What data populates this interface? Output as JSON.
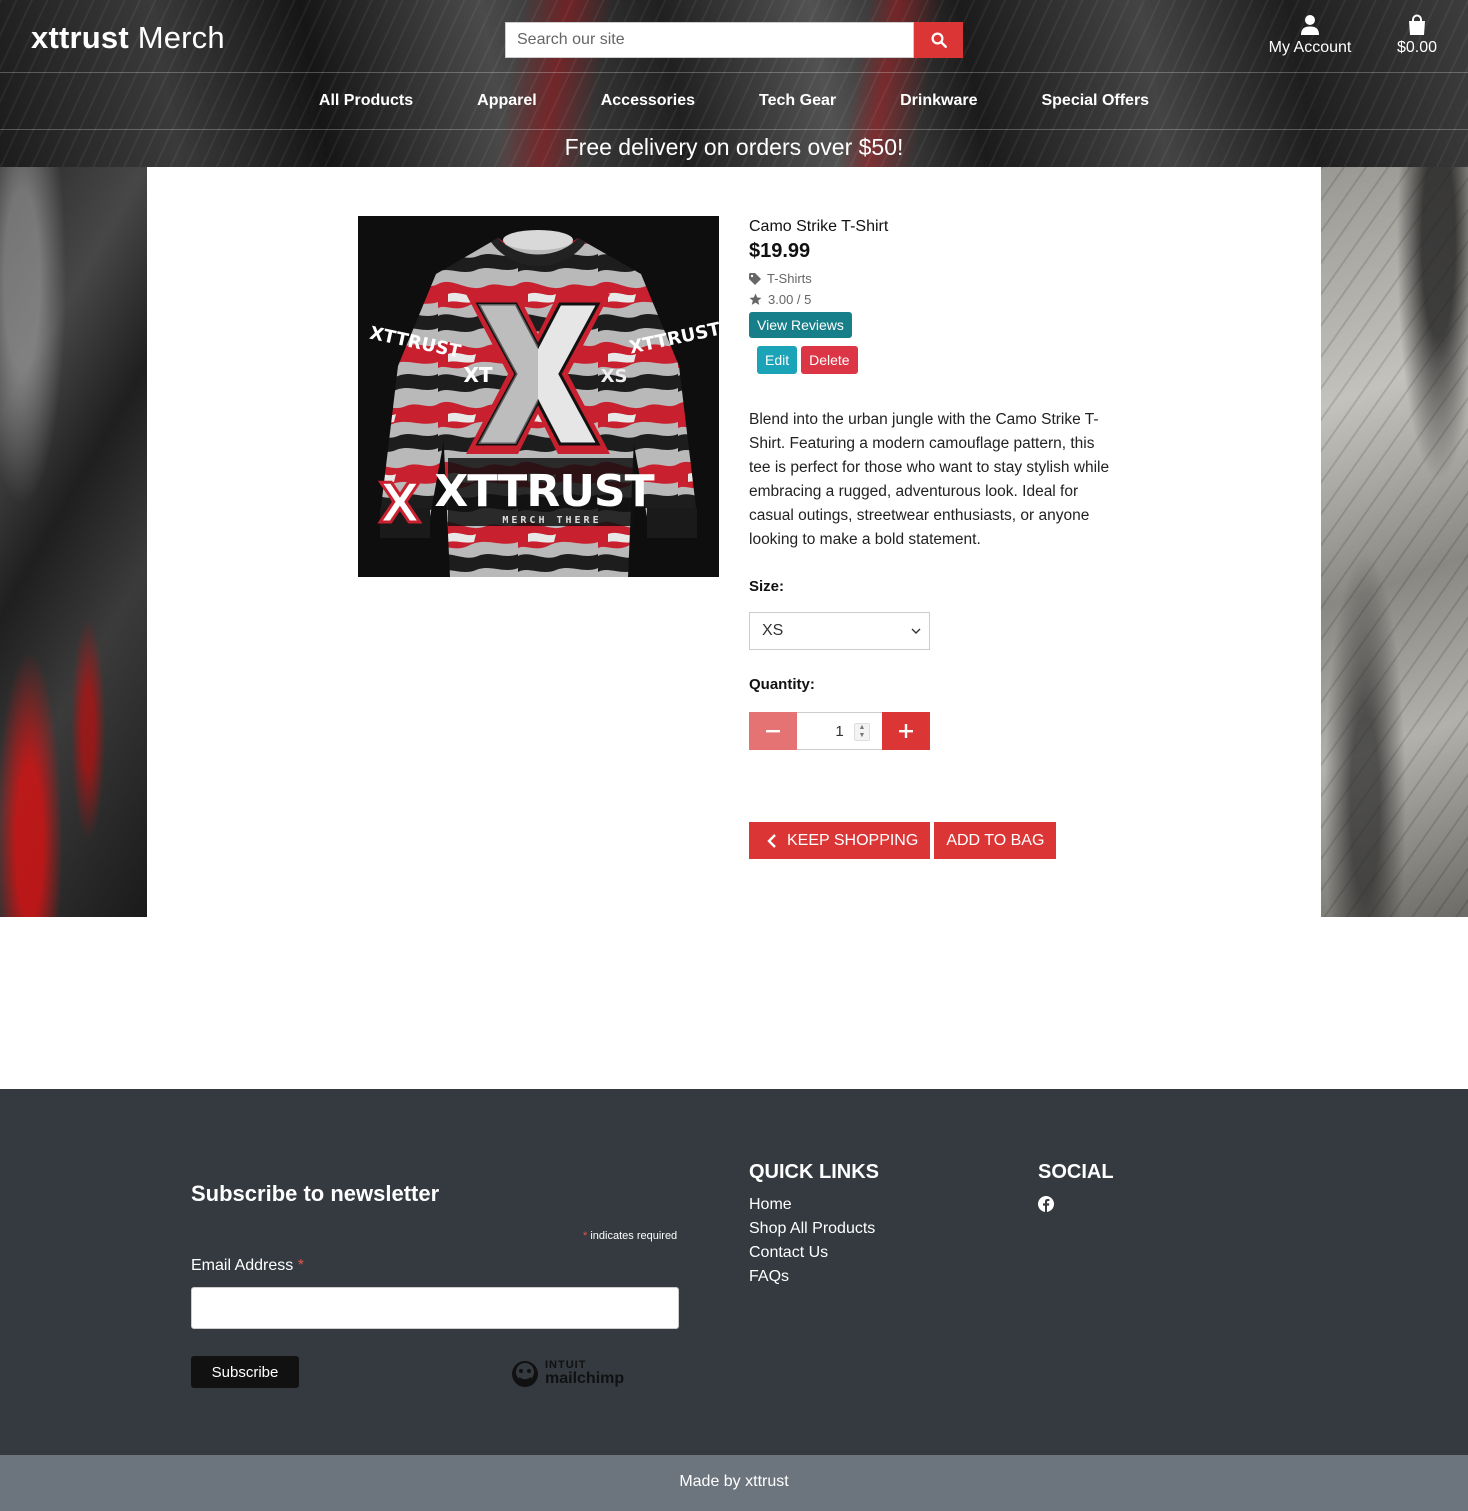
{
  "header": {
    "brand_bold": "xttrust",
    "brand_light": "Merch",
    "search_placeholder": "Search our site",
    "account_label": "My Account",
    "bag_total": "$0.00"
  },
  "nav": [
    "All Products",
    "Apparel",
    "Accessories",
    "Tech Gear",
    "Drinkware",
    "Special Offers"
  ],
  "promo": "Free delivery on orders over $50!",
  "product": {
    "name": "Camo Strike T-Shirt",
    "price": "$19.99",
    "category": "T-Shirts",
    "rating": "3.00 / 5",
    "view_reviews": "View Reviews",
    "edit": "Edit",
    "delete": "Delete",
    "description": "Blend into the urban jungle with the Camo Strike T-Shirt. Featuring a modern camouflage pattern, this tee is perfect for those who want to stay stylish while embracing a rugged, adventurous look. Ideal for casual outings, streetwear enthusiasts, or anyone looking to make a bold statement.",
    "size_label": "Size:",
    "size_value": "XS",
    "quantity_label": "Quantity:",
    "quantity_value": "1",
    "keep_shopping": "KEEP SHOPPING",
    "add_to_bag": "ADD TO BAG",
    "image_text": {
      "big": "XTTRUST",
      "sub": "MERCH THERE",
      "sleeve": "XTTRUST",
      "xt": "XT",
      "xs": "XS",
      "x": "X"
    }
  },
  "footer": {
    "newsletter_title": "Subscribe to newsletter",
    "required_note": "indicates required",
    "required_star": "*",
    "email_label": "Email Address",
    "subscribe": "Subscribe",
    "mailchimp_line1": "INTUIT",
    "mailchimp_line2": "mailchimp",
    "quick_links_title": "QUICK LINKS",
    "quick_links": [
      "Home",
      "Shop All Products",
      "Contact Us",
      "FAQs"
    ],
    "social_title": "SOCIAL",
    "made_by": "Made by xttrust"
  },
  "colors": {
    "accent_red": "#dc3535",
    "teal": "#177f8a",
    "edit_blue": "#1ba3b8",
    "delete_red": "#dc3545",
    "footer_dark": "#343a40",
    "footer_bar": "#6c757d"
  }
}
